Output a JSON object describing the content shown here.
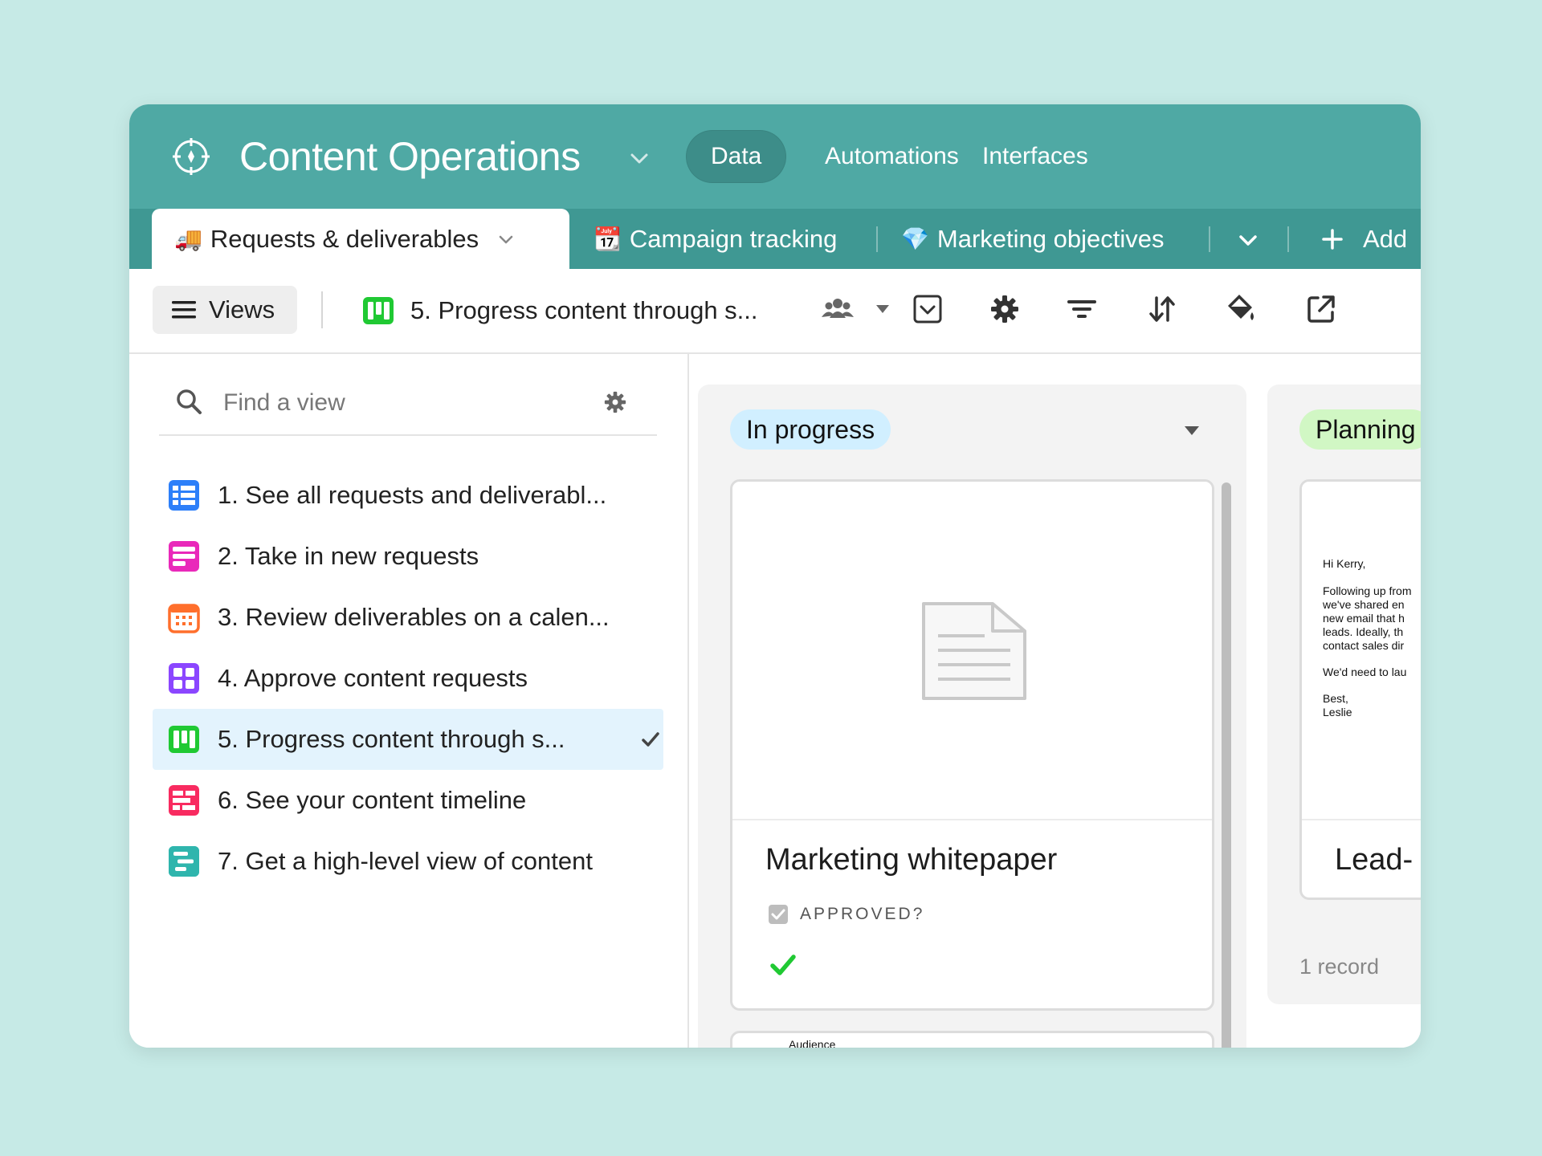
{
  "base": {
    "title": "Content Operations",
    "icon": "compass-icon"
  },
  "top_nav": [
    {
      "label": "Data",
      "active": true
    },
    {
      "label": "Automations",
      "active": false
    },
    {
      "label": "Interfaces",
      "active": false
    }
  ],
  "tables": {
    "items": [
      {
        "emoji": "🚚",
        "label": "Requests & deliverables",
        "active": true
      },
      {
        "emoji": "📆",
        "label": "Campaign tracking",
        "active": false
      },
      {
        "emoji": "💎",
        "label": "Marketing objectives",
        "active": false
      }
    ],
    "add_label": "Add"
  },
  "viewbar": {
    "views_label": "Views",
    "current_view": "5. Progress content through s..."
  },
  "sidebar": {
    "search_placeholder": "Find a view",
    "views": [
      {
        "label": "1. See all requests and deliverabl...",
        "icon": "grid-view-icon",
        "color": "#2d7ff9"
      },
      {
        "label": "2. Take in new requests",
        "icon": "form-view-icon",
        "color": "#e929ba"
      },
      {
        "label": "3. Review deliverables on a calen...",
        "icon": "calendar-view-icon",
        "color": "#ff6f2c"
      },
      {
        "label": "4. Approve content requests",
        "icon": "gallery-view-icon",
        "color": "#8b46ff"
      },
      {
        "label": "5. Progress content through s...",
        "icon": "kanban-view-icon",
        "color": "#20c933",
        "selected": true
      },
      {
        "label": "6. See your content timeline",
        "icon": "timeline-view-icon",
        "color": "#f82b60"
      },
      {
        "label": "7. Get a high-level view of content",
        "icon": "gantt-view-icon",
        "color": "#20d9d2"
      }
    ]
  },
  "board": {
    "columns": [
      {
        "label": "In progress",
        "color": "#d1efff",
        "cards": [
          {
            "title": "Marketing whitepaper",
            "field_label": "APPROVED?",
            "approved": true
          },
          {
            "cover_text": "Audience"
          }
        ]
      },
      {
        "label": "Planning",
        "color": "#d1f7c4",
        "cards": [
          {
            "title": "Lead-",
            "cover_lines": [
              "Hi Kerry,",
              "Following up from",
              "we've shared en",
              "new email that h",
              "leads. Ideally, th",
              "contact sales dir",
              "We'd need to lau",
              "Best,",
              "Leslie"
            ]
          }
        ],
        "record_count": "1 record"
      }
    ]
  }
}
